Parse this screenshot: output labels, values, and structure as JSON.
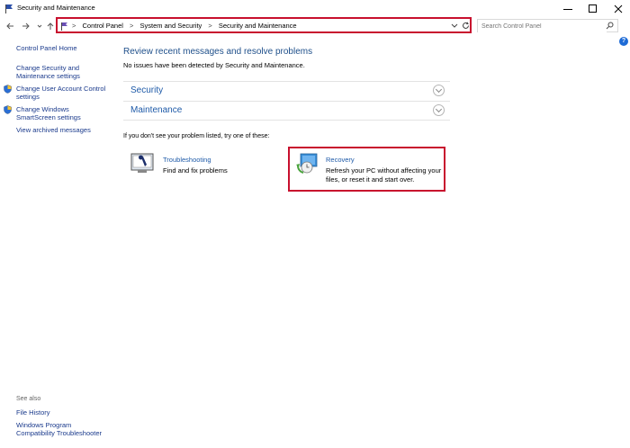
{
  "window": {
    "title": "Security and Maintenance"
  },
  "address": {
    "crumbs": [
      "Control Panel",
      "System and Security",
      "Security and Maintenance"
    ]
  },
  "search": {
    "placeholder": "Search Control Panel"
  },
  "sidebar": {
    "items": [
      {
        "label": "Control Panel Home"
      },
      {
        "label": "Change Security and Maintenance settings"
      },
      {
        "label": "Change User Account Control settings"
      },
      {
        "label": "Change Windows SmartScreen settings"
      },
      {
        "label": "View archived messages"
      }
    ],
    "see_also": {
      "heading": "See also",
      "items": [
        {
          "label": "File History"
        },
        {
          "label": "Windows Program Compatibility Troubleshooter"
        }
      ]
    }
  },
  "main": {
    "heading": "Review recent messages and resolve problems",
    "subtext": "No issues have been detected by Security and Maintenance.",
    "sections": [
      {
        "label": "Security"
      },
      {
        "label": "Maintenance"
      }
    ],
    "hint": "If you don't see your problem listed, try one of these:",
    "tools": [
      {
        "title": "Troubleshooting",
        "desc": "Find and fix problems"
      },
      {
        "title": "Recovery",
        "desc": "Refresh your PC without affecting your files, or reset it and start over."
      }
    ]
  }
}
